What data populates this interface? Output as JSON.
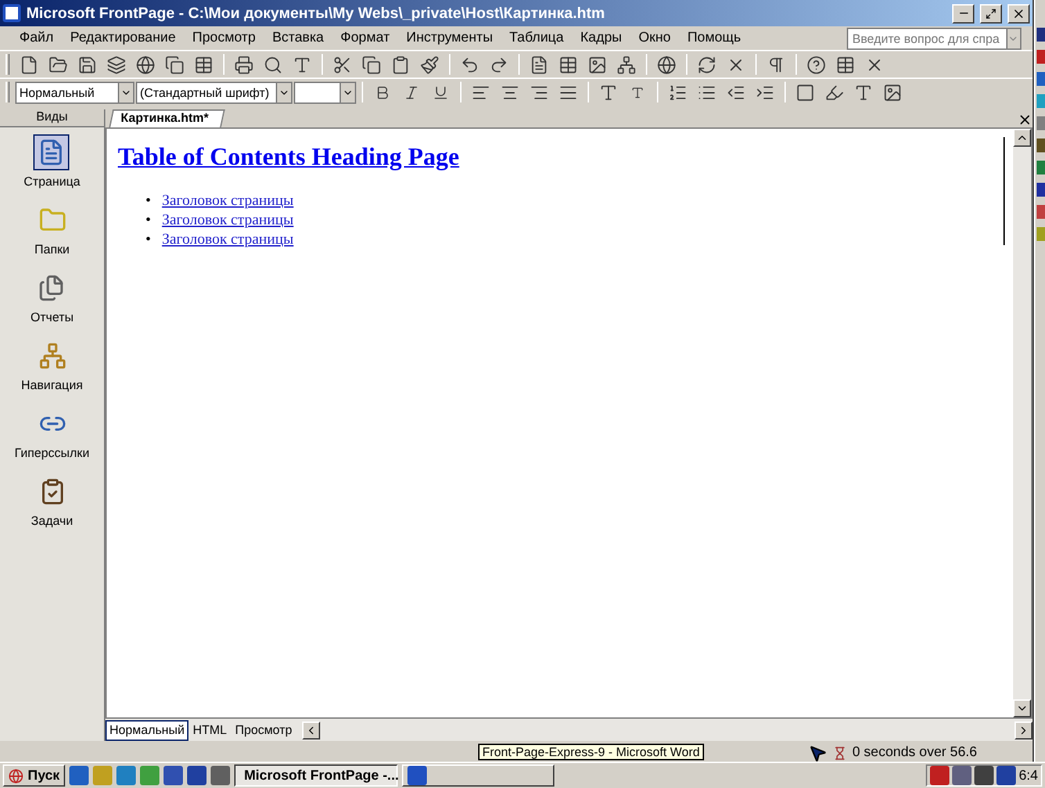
{
  "window": {
    "title": "Microsoft FrontPage - C:\\Мои документы\\My Webs\\_private\\Host\\Картинка.htm"
  },
  "menu": [
    "Файл",
    "Редактирование",
    "Просмотр",
    "Вставка",
    "Формат",
    "Инструменты",
    "Таблица",
    "Кадры",
    "Окно",
    "Помощь"
  ],
  "help_search": {
    "placeholder": "Введите вопрос для спра"
  },
  "format_bar": {
    "style": "Нормальный",
    "font": "(Стандартный шрифт)"
  },
  "views": {
    "title": "Виды",
    "items": [
      {
        "label": "Страница",
        "selected": true
      },
      {
        "label": "Папки",
        "selected": false
      },
      {
        "label": "Отчеты",
        "selected": false
      },
      {
        "label": "Навигация",
        "selected": false
      },
      {
        "label": "Гиперссылки",
        "selected": false
      },
      {
        "label": "Задачи",
        "selected": false
      }
    ]
  },
  "document_tab": {
    "label": "Картинка.htm*"
  },
  "page": {
    "heading": "Table of Contents Heading Page",
    "links": [
      {
        "bullet": "•",
        "text": "Заголовок страницы"
      },
      {
        "bullet": "•",
        "text": "Заголовок страницы"
      },
      {
        "bullet": "•",
        "text": "Заголовок страницы"
      }
    ]
  },
  "view_tabs": [
    {
      "label": "Нормальный",
      "selected": true
    },
    {
      "label": "HTML",
      "selected": false
    },
    {
      "label": "Просмотр",
      "selected": false
    }
  ],
  "status_bar": {
    "timing": "0 seconds over 56.6"
  },
  "taskbar": {
    "start": "Пуск",
    "tasks": [
      {
        "label": "Microsoft FrontPage -...",
        "selected": true
      },
      {
        "selected": false
      }
    ],
    "tooltip": "Front-Page-Express-9 - Microsoft Word",
    "clock": "6:4"
  }
}
